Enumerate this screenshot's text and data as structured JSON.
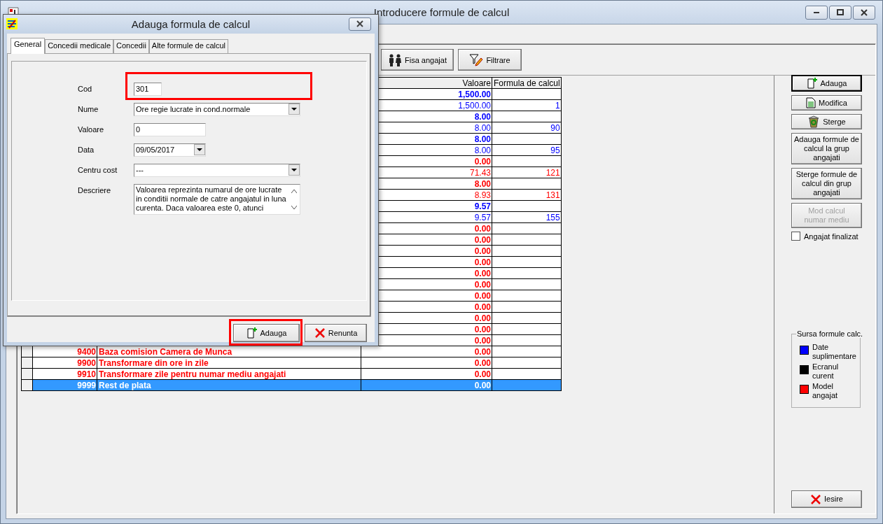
{
  "window": {
    "title": "Introducere formule de calcul"
  },
  "toolbar": {
    "buttons": [
      {
        "label": "Fisa angajat"
      },
      {
        "label": "Filtrare"
      }
    ]
  },
  "table": {
    "columns": [
      "Valoare",
      "Formula de calcul"
    ],
    "rows": [
      {
        "value": "1,500.00",
        "bold": true,
        "color": "#0000ff",
        "selected": false
      },
      {
        "value": "1,500.00",
        "formula": "1",
        "bold": false,
        "color": "#0000ff",
        "selected": false
      },
      {
        "value": "8.00",
        "bold": true,
        "color": "#0000ff",
        "selected": false
      },
      {
        "value": "8.00",
        "formula": "90",
        "bold": false,
        "color": "#0000ff",
        "selected": false
      },
      {
        "value": "8.00",
        "bold": true,
        "color": "#0000ff",
        "selected": false
      },
      {
        "value": "8.00",
        "formula": "95",
        "bold": false,
        "color": "#0000ff",
        "selected": false
      },
      {
        "value": "0.00",
        "bold": true,
        "color": "#ff0000",
        "selected": false
      },
      {
        "value": "71.43",
        "formula": "121",
        "bold": false,
        "color": "#ff0000",
        "selected": false
      },
      {
        "value": "8.00",
        "bold": true,
        "color": "#ff0000",
        "selected": false
      },
      {
        "value": "8.93",
        "formula": "131",
        "bold": false,
        "color": "#ff0000",
        "selected": false
      },
      {
        "value": "9.57",
        "bold": true,
        "color": "#0000ff",
        "selected": false
      },
      {
        "value": "9.57",
        "formula": "155",
        "bold": false,
        "color": "#0000ff",
        "selected": false
      },
      {
        "value": "0.00",
        "bold": true,
        "color": "#ff0000",
        "selected": false
      },
      {
        "value": "0.00",
        "bold": true,
        "color": "#ff0000",
        "selected": false
      },
      {
        "value": "0.00",
        "bold": true,
        "color": "#ff0000",
        "selected": false
      },
      {
        "value": "0.00",
        "bold": true,
        "color": "#ff0000",
        "selected": false
      },
      {
        "value": "0.00",
        "bold": true,
        "color": "#ff0000",
        "selected": false
      },
      {
        "value": "0.00",
        "bold": true,
        "color": "#ff0000",
        "selected": false
      },
      {
        "value": "0.00",
        "bold": true,
        "color": "#ff0000",
        "selected": false
      },
      {
        "value": "0.00",
        "bold": true,
        "color": "#ff0000",
        "selected": false
      },
      {
        "value": "0.00",
        "bold": true,
        "color": "#ff0000",
        "selected": false
      },
      {
        "value": "0.00",
        "bold": true,
        "color": "#ff0000",
        "selected": false
      },
      {
        "value": "0.00",
        "bold": true,
        "color": "#ff0000",
        "selected": false
      },
      {
        "code": "9400",
        "name": "Baza comision Camera de Munca",
        "value": "0.00",
        "bold": true,
        "color": "#ff0000",
        "selected": false
      },
      {
        "code": "9900",
        "name": "Transformare din ore in zile",
        "value": "0.00",
        "bold": true,
        "color": "#ff0000",
        "selected": false
      },
      {
        "code": "9910",
        "name": "Transformare zile pentru numar mediu angajati",
        "value": "0.00",
        "bold": true,
        "color": "#ff0000",
        "selected": false
      },
      {
        "code": "9999",
        "name": "Rest de plata",
        "value": "0.00",
        "bold": true,
        "selected": true
      }
    ]
  },
  "side_buttons": [
    {
      "label": "Adauga",
      "default": true,
      "disabled": false
    },
    {
      "label": "Modifica",
      "default": false,
      "disabled": false
    },
    {
      "label": "Sterge",
      "default": false,
      "disabled": false
    },
    {
      "label": "Adauga formule de calcul la grup angajati",
      "default": false,
      "disabled": false
    },
    {
      "label": "Sterge formule de calcul din grup angajati",
      "default": false,
      "disabled": false
    },
    {
      "label": "Mod calcul numar mediu",
      "default": false,
      "disabled": true
    }
  ],
  "checkbox": {
    "label": "Angajat finalizat",
    "checked": false
  },
  "legend": {
    "title": "Sursa formule calc.",
    "items": [
      {
        "label": "Date suplimentare",
        "color": "#0000ff"
      },
      {
        "label": "Ecranul curent",
        "color": "#000000"
      },
      {
        "label": "Model angajat",
        "color": "#ff0000"
      }
    ]
  },
  "exit_button": {
    "label": "Iesire"
  },
  "dialog": {
    "title": "Adauga formula de calcul",
    "tabs": [
      {
        "label": "General",
        "selected": true
      },
      {
        "label": "Concedii medicale",
        "selected": false
      },
      {
        "label": "Concedii",
        "selected": false
      },
      {
        "label": "Alte formule de calcul",
        "selected": false
      }
    ],
    "fields": [
      {
        "label": "Cod",
        "kind": "text",
        "value": "301",
        "highlighted": true
      },
      {
        "label": "Nume",
        "kind": "combo",
        "value": "Ore regie lucrate in cond.normale",
        "highlighted": false
      },
      {
        "label": "Valoare",
        "kind": "text",
        "value": "0",
        "highlighted": false
      },
      {
        "label": "Data",
        "kind": "date",
        "value": "09/05/2017",
        "highlighted": false
      },
      {
        "label": "Centru cost",
        "kind": "combo",
        "value": "---",
        "highlighted": false
      },
      {
        "label": "Descriere",
        "kind": "memo",
        "value": "Valoarea reprezinta numarul de ore lucrate in conditii normale de catre angajatul in luna curenta. Daca valoarea este 0, atunci",
        "highlighted": false
      }
    ],
    "buttons": [
      {
        "label": "Adauga",
        "highlighted": true
      },
      {
        "label": "Renunta",
        "highlighted": false
      }
    ]
  }
}
